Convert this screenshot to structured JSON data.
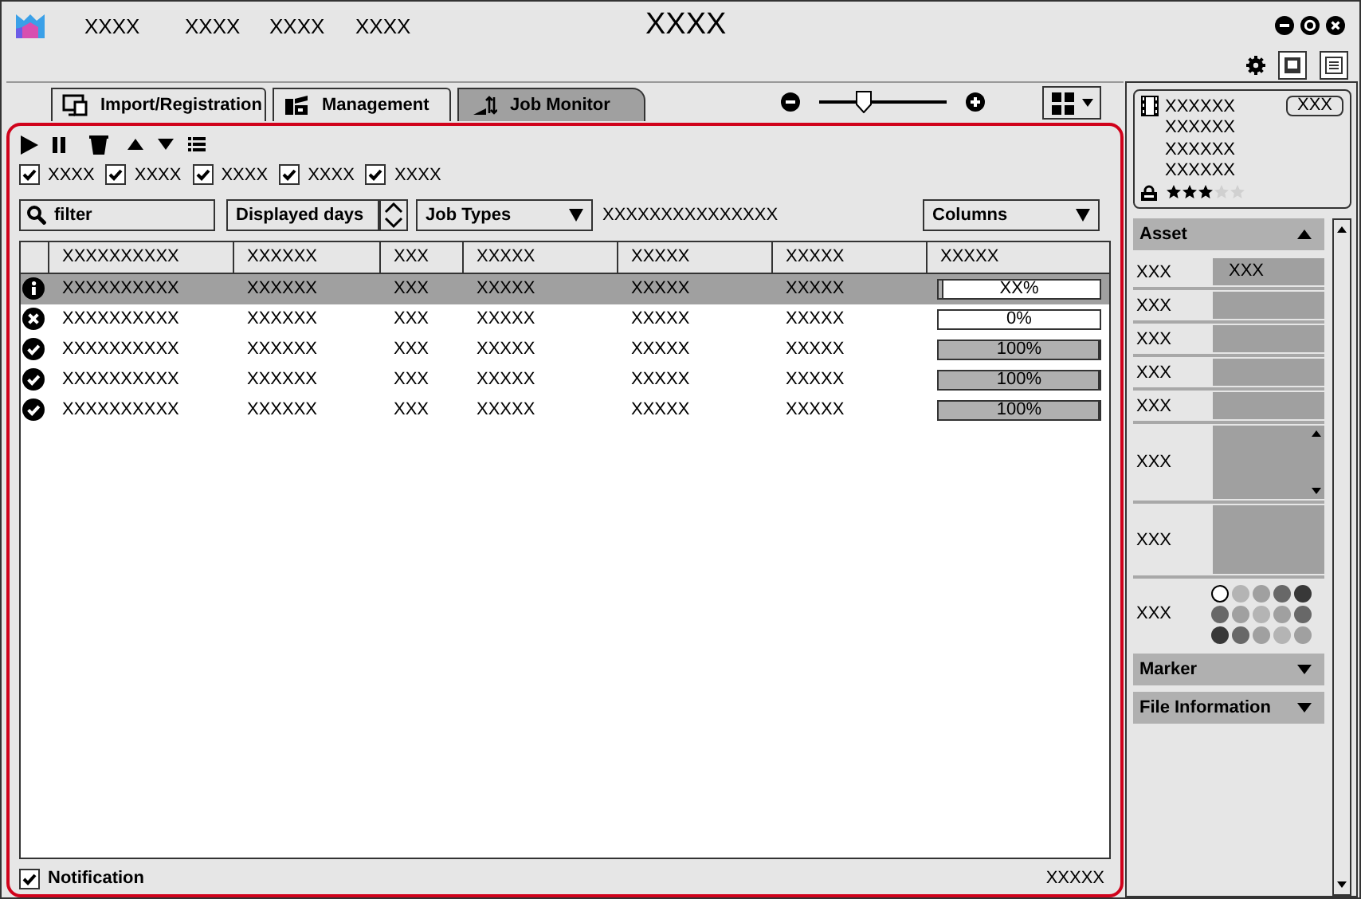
{
  "app": {
    "menu": [
      "XXXX",
      "XXXX",
      "XXXX",
      "XXXX"
    ],
    "title": "XXXX"
  },
  "tabs": [
    {
      "label": "Import/Registration",
      "selected": false
    },
    {
      "label": "Management",
      "selected": false
    },
    {
      "label": "Job Monitor",
      "selected": true
    }
  ],
  "zoom": {
    "level": 0.35
  },
  "job_monitor": {
    "filters": [
      {
        "label": "XXXX",
        "checked": true
      },
      {
        "label": "XXXX",
        "checked": true
      },
      {
        "label": "XXXX",
        "checked": true
      },
      {
        "label": "XXXX",
        "checked": true
      },
      {
        "label": "XXXX",
        "checked": true
      }
    ],
    "search": {
      "placeholder": "filter"
    },
    "days": {
      "value": "Displayed days"
    },
    "job_types": {
      "value": "Job Types"
    },
    "summary": "XXXXXXXXXXXXXXX",
    "columns_button": "Columns",
    "table": {
      "columns": [
        "XXXXXXXXXX",
        "XXXXXX",
        "XXX",
        "XXXXX",
        "XXXXX",
        "XXXXX",
        "XXXXX"
      ],
      "rows": [
        {
          "kind": "info",
          "selected": true,
          "cells": [
            "XXXXXXXXXX",
            "XXXXXX",
            "XXX",
            "XXXXX",
            "XXXXX",
            "XXXXX"
          ],
          "progress": {
            "level": 0.03,
            "label": "XX%"
          }
        },
        {
          "kind": "error",
          "selected": false,
          "cells": [
            "XXXXXXXXXX",
            "XXXXXX",
            "XXX",
            "XXXXX",
            "XXXXX",
            "XXXXX"
          ],
          "progress": {
            "level": 0,
            "label": "0%"
          }
        },
        {
          "kind": "done",
          "selected": false,
          "cells": [
            "XXXXXXXXXX",
            "XXXXXX",
            "XXX",
            "XXXXX",
            "XXXXX",
            "XXXXX"
          ],
          "progress": {
            "level": 1,
            "label": "100%"
          }
        },
        {
          "kind": "done",
          "selected": false,
          "cells": [
            "XXXXXXXXXX",
            "XXXXXX",
            "XXX",
            "XXXXX",
            "XXXXX",
            "XXXXX"
          ],
          "progress": {
            "level": 1,
            "label": "100%"
          }
        },
        {
          "kind": "done",
          "selected": false,
          "cells": [
            "XXXXXXXXXX",
            "XXXXXX",
            "XXX",
            "XXXXX",
            "XXXXX",
            "XXXXX"
          ],
          "progress": {
            "level": 1,
            "label": "100%"
          }
        }
      ]
    },
    "notification": {
      "label": "Notification",
      "checked": true
    },
    "status": "XXXXX"
  },
  "sidebar": {
    "clip": {
      "lines": [
        "XXXXXX",
        "XXXXXX",
        "XXXXXX",
        "XXXXXX"
      ],
      "badge": "XXX",
      "stars": 3
    },
    "sections": [
      {
        "title": "Asset",
        "expanded": true,
        "fields": [
          {
            "kind": "text",
            "label": "XXX",
            "value": "XXX"
          },
          {
            "kind": "text",
            "label": "XXX"
          },
          {
            "kind": "text",
            "label": "XXX"
          },
          {
            "kind": "text",
            "label": "XXX"
          },
          {
            "kind": "text",
            "label": "XXX"
          },
          {
            "kind": "list",
            "label": "XXX"
          },
          {
            "kind": "box",
            "label": "XXX"
          },
          {
            "kind": "colors",
            "label": "XXX",
            "colors": [
              {
                "color": "#ffffff",
                "selected": true
              },
              {
                "color": "#b4b4b4",
                "selected": false
              },
              {
                "color": "#a0a0a0",
                "selected": false
              },
              {
                "color": "#686868",
                "selected": false
              },
              {
                "color": "#383838",
                "selected": false
              },
              {
                "color": "#686868",
                "selected": false
              },
              {
                "color": "#a0a0a0",
                "selected": false
              },
              {
                "color": "#b4b4b4",
                "selected": false
              },
              {
                "color": "#a0a0a0",
                "selected": false
              },
              {
                "color": "#686868",
                "selected": false
              },
              {
                "color": "#383838",
                "selected": false
              },
              {
                "color": "#686868",
                "selected": false
              },
              {
                "color": "#a0a0a0",
                "selected": false
              },
              {
                "color": "#b4b4b4",
                "selected": false
              },
              {
                "color": "#a0a0a0",
                "selected": false
              }
            ]
          }
        ]
      },
      {
        "title": "Marker",
        "expanded": false
      },
      {
        "title": "File Information",
        "expanded": false
      }
    ]
  }
}
